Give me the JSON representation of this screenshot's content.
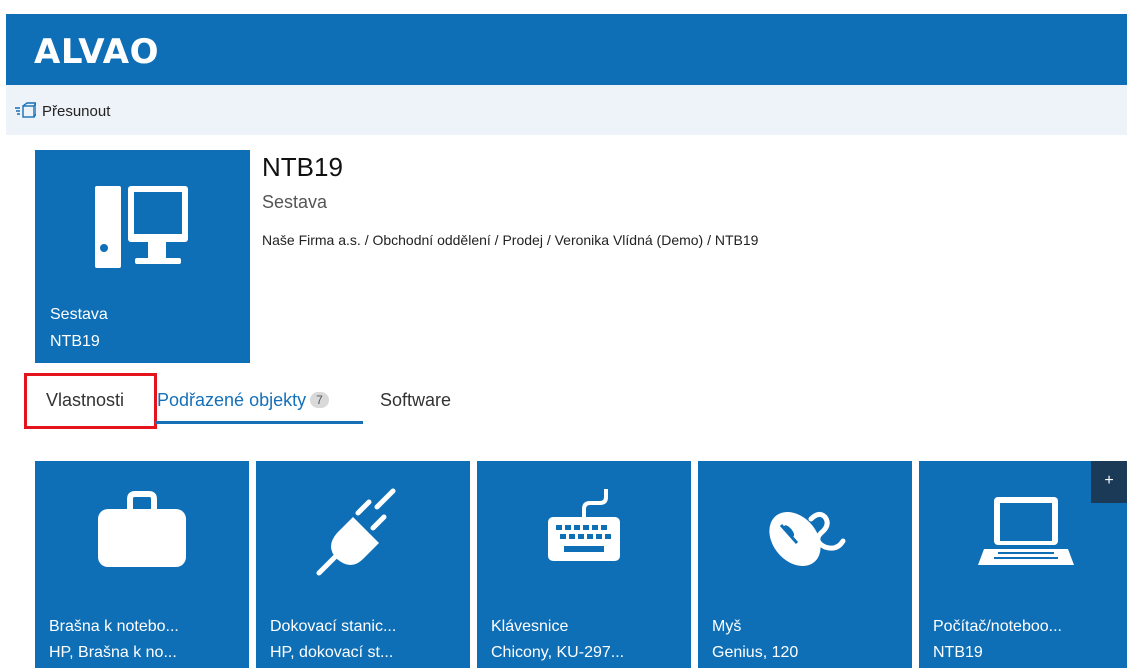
{
  "app": {
    "logo": "ALVAO"
  },
  "toolbar": {
    "move_label": "Přesunout"
  },
  "object": {
    "tile_caption_type": "Sestava",
    "tile_caption_name": "NTB19",
    "title": "NTB19",
    "subtitle": "Sestava",
    "path": "Naše Firma a.s. / Obchodní oddělení / Prodej / Veronika Vlídná (Demo) / NTB19"
  },
  "tabs": {
    "properties": "Vlastnosti",
    "children": "Podřazené objekty",
    "children_count": "7",
    "software": "Software"
  },
  "children": [
    {
      "icon": "briefcase-icon",
      "line1": "Brašna k notebo...",
      "line2": "HP, Brašna k no..."
    },
    {
      "icon": "docking-plug-icon",
      "line1": "Dokovací stanic...",
      "line2": "HP, dokovací st..."
    },
    {
      "icon": "keyboard-icon",
      "line1": "Klávesnice",
      "line2": "Chicony, KU-297..."
    },
    {
      "icon": "mouse-icon",
      "line1": "Myš",
      "line2": "Genius, 120"
    },
    {
      "icon": "laptop-icon",
      "line1": "Počítač/noteboo...",
      "line2": "NTB19"
    }
  ],
  "add_button": {
    "label": "+"
  },
  "colors": {
    "brand": "#0f6fb6",
    "highlight": "#e3141b",
    "tab_active": "#1570b8"
  }
}
